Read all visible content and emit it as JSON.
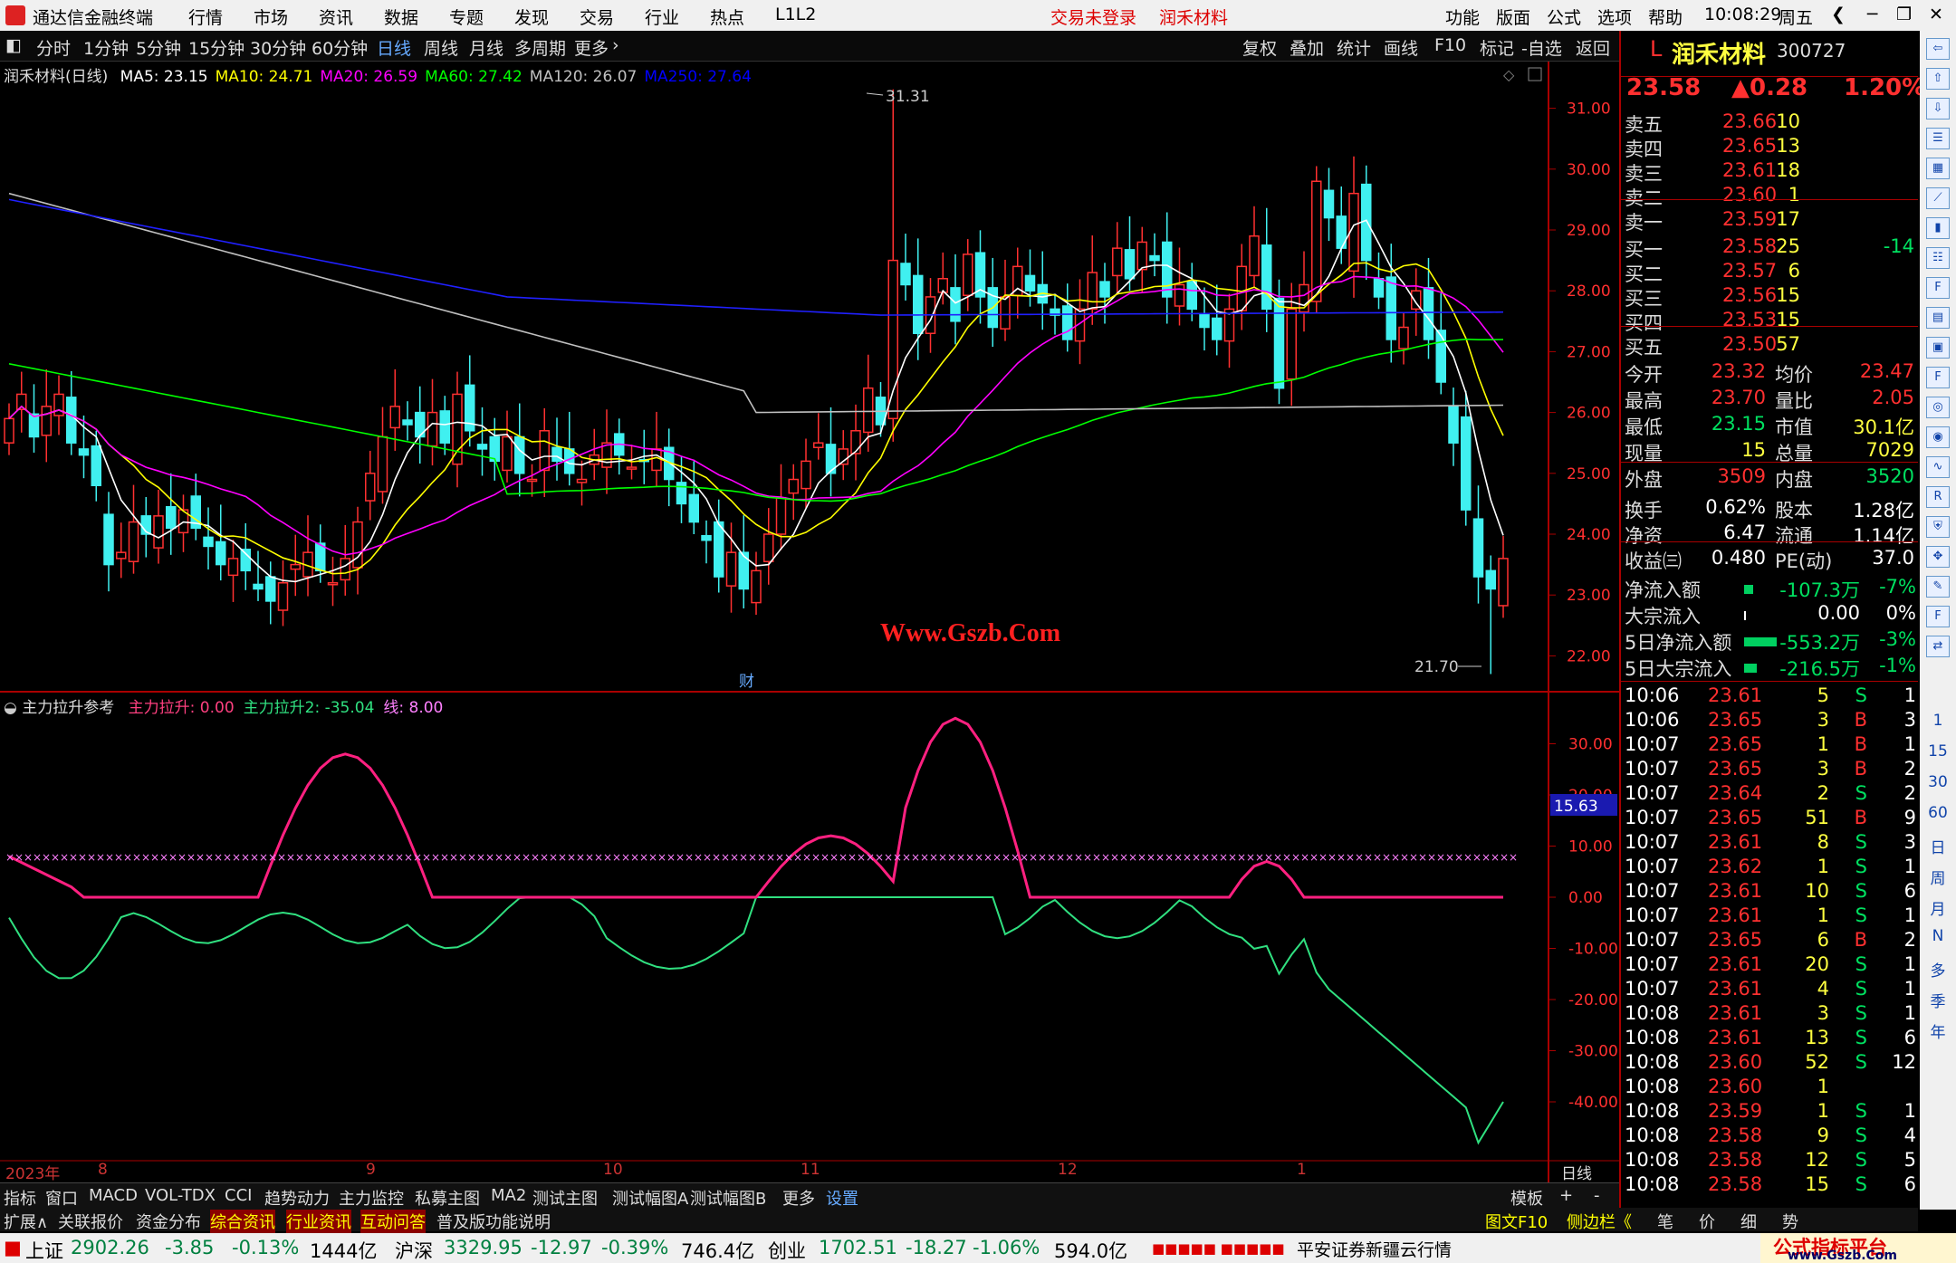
{
  "titlebar": {
    "app": "通达信金融终端",
    "menu": [
      "行情",
      "市场",
      "资讯",
      "数据",
      "专题",
      "发现",
      "交易",
      "行业",
      "热点",
      "L1L2"
    ],
    "trade_status": "交易未登录",
    "stock_center": "润禾材料",
    "right_menu": [
      "功能",
      "版面",
      "公式",
      "选项",
      "帮助"
    ],
    "time": "10:08:29",
    "weekday": "周五"
  },
  "toolbar": {
    "periods": [
      "分时",
      "1分钟",
      "5分钟",
      "15分钟",
      "30分钟",
      "60分钟",
      "日线",
      "周线",
      "月线",
      "多周期",
      "更多"
    ],
    "active": "日线",
    "right": [
      "复权",
      "叠加",
      "统计",
      "画线",
      "F10",
      "标记",
      "-自选",
      "返回"
    ]
  },
  "main_legend": {
    "name": "润禾材料(日线)",
    "items": [
      {
        "label": "MA5: 23.15",
        "color": "#ffffff"
      },
      {
        "label": "MA10: 24.71",
        "color": "#ffff00"
      },
      {
        "label": "MA20: 26.59",
        "color": "#ff00ff"
      },
      {
        "label": "MA60: 27.42",
        "color": "#00ff00"
      },
      {
        "label": "MA120: 26.07",
        "color": "#c0c0c0"
      },
      {
        "label": "MA250: 27.64",
        "color": "#0000ff"
      }
    ]
  },
  "price_axis": [
    "31.00",
    "30.00",
    "29.00",
    "28.00",
    "27.00",
    "26.00",
    "25.00",
    "24.00",
    "23.00",
    "22.00"
  ],
  "price_marks": {
    "high": "31.31",
    "low": "21.70"
  },
  "watermark": "Www.Gszb.Com",
  "cai": "财",
  "sub_legend": {
    "name": "主力拉升参考",
    "items": [
      {
        "label": "主力拉升: 0.00",
        "color": "#ff4080"
      },
      {
        "label": "主力拉升2: -35.04",
        "color": "#30e080"
      },
      {
        "label": "线: 8.00",
        "color": "#ff80ff"
      }
    ]
  },
  "sub_axis": [
    "30.00",
    "20.00",
    "10.00",
    "0.00",
    "-10.00",
    "-20.00",
    "-30.00",
    "-40.00"
  ],
  "sub_mark": "15.63",
  "xaxis": {
    "labels": [
      "2023年",
      "8",
      "9",
      "10",
      "11",
      "12",
      "1"
    ],
    "right": "日线"
  },
  "chart_data": {
    "type": "candlestick",
    "ylim": [
      21.5,
      31.5
    ],
    "high": 31.31,
    "low": 21.7,
    "closes": [
      25.9,
      26.3,
      25.6,
      26.1,
      26.3,
      25.5,
      25.3,
      24.8,
      23.5,
      23.7,
      24.2,
      24.0,
      24.3,
      24.1,
      24.4,
      24.1,
      23.8,
      23.5,
      23.6,
      23.4,
      23.1,
      22.9,
      23.2,
      23.5,
      23.7,
      23.4,
      23.2,
      23.6,
      24.2,
      25.0,
      25.6,
      26.1,
      25.8,
      25.6,
      26.0,
      25.5,
      26.3,
      25.7,
      25.4,
      25.2,
      25.6,
      25.0,
      24.9,
      25.7,
      25.2,
      25.0,
      24.9,
      25.3,
      25.5,
      25.3,
      25.1,
      25.2,
      25.4,
      24.9,
      24.5,
      24.2,
      23.9,
      23.3,
      23.7,
      23.1,
      23.4,
      24.0,
      24.6,
      24.9,
      25.2,
      25.5,
      25.0,
      25.4,
      25.7,
      26.4,
      25.8,
      28.5,
      28.1,
      27.3,
      27.9,
      28.2,
      27.5,
      28.6,
      27.9,
      27.4,
      27.9,
      28.4,
      28.0,
      27.8,
      27.6,
      27.2,
      27.7,
      28.3,
      27.9,
      28.7,
      28.2,
      28.8,
      28.5,
      27.9,
      28.1,
      27.7,
      27.4,
      27.2,
      27.7,
      28.4,
      28.9,
      27.7,
      26.4,
      27.7,
      28.1,
      29.8,
      29.2,
      28.7,
      29.6,
      28.5,
      27.9,
      27.2,
      27.4,
      28.0,
      27.2,
      26.5,
      25.5,
      24.4,
      23.3,
      23.1,
      23.6
    ],
    "ma_last": {
      "MA5": 23.15,
      "MA10": 24.71,
      "MA20": 26.59,
      "MA60": 27.42,
      "MA120": 26.07,
      "MA250": 27.64
    }
  },
  "quote": {
    "name": "润禾材料",
    "code": "300727",
    "price": "23.58",
    "change": "▲0.28",
    "pct": "1.20%",
    "asks": [
      [
        "卖五",
        "23.66",
        "10"
      ],
      [
        "卖四",
        "23.65",
        "13"
      ],
      [
        "卖三",
        "23.61",
        "18"
      ],
      [
        "卖二",
        "23.60",
        "1"
      ],
      [
        "卖一",
        "23.59",
        "17"
      ]
    ],
    "bids": [
      [
        "买一",
        "23.58",
        "25",
        "-14"
      ],
      [
        "买二",
        "23.57",
        "6",
        ""
      ],
      [
        "买三",
        "23.56",
        "15",
        ""
      ],
      [
        "买四",
        "23.53",
        "15",
        ""
      ],
      [
        "买五",
        "23.50",
        "57",
        ""
      ]
    ],
    "stats": [
      [
        "今开",
        "23.32",
        "均价",
        "23.47"
      ],
      [
        "最高",
        "23.70",
        "量比",
        "2.05"
      ],
      [
        "最低",
        "23.15",
        "市值",
        "30.1亿"
      ],
      [
        "现量",
        "15",
        "总量",
        "7029"
      ],
      [
        "外盘",
        "3509",
        "内盘",
        "3520"
      ]
    ],
    "fin": [
      [
        "换手",
        "0.62%",
        "股本",
        "1.28亿"
      ],
      [
        "净资",
        "6.47",
        "流通",
        "1.14亿"
      ],
      [
        "收益㈢",
        "0.480",
        "PE(动)",
        "37.0"
      ]
    ],
    "flow": [
      [
        "净流入额",
        "-107.3万",
        "-7%"
      ],
      [
        "大宗流入",
        "0.00",
        "0%"
      ],
      [
        "5日净流入额",
        "-553.2万",
        "-3%"
      ],
      [
        "5日大宗流入",
        "-216.5万",
        "-1%"
      ]
    ],
    "ticks": [
      [
        "10:06",
        "23.61",
        "5",
        "S",
        "1"
      ],
      [
        "10:06",
        "23.65",
        "3",
        "B",
        "3"
      ],
      [
        "10:07",
        "23.65",
        "1",
        "B",
        "1"
      ],
      [
        "10:07",
        "23.65",
        "3",
        "B",
        "2"
      ],
      [
        "10:07",
        "23.64",
        "2",
        "S",
        "2"
      ],
      [
        "10:07",
        "23.65",
        "51",
        "B",
        "9"
      ],
      [
        "10:07",
        "23.61",
        "8",
        "S",
        "3"
      ],
      [
        "10:07",
        "23.62",
        "1",
        "S",
        "1"
      ],
      [
        "10:07",
        "23.61",
        "10",
        "S",
        "6"
      ],
      [
        "10:07",
        "23.61",
        "1",
        "S",
        "1"
      ],
      [
        "10:07",
        "23.65",
        "6",
        "B",
        "2"
      ],
      [
        "10:07",
        "23.61",
        "20",
        "S",
        "1"
      ],
      [
        "10:07",
        "23.61",
        "4",
        "S",
        "1"
      ],
      [
        "10:08",
        "23.61",
        "3",
        "S",
        "1"
      ],
      [
        "10:08",
        "23.61",
        "13",
        "S",
        "6"
      ],
      [
        "10:08",
        "23.60",
        "52",
        "S",
        "12"
      ],
      [
        "10:08",
        "23.60",
        "1",
        "",
        ""
      ],
      [
        "10:08",
        "23.59",
        "1",
        "S",
        "1"
      ],
      [
        "10:08",
        "23.58",
        "9",
        "S",
        "4"
      ],
      [
        "10:08",
        "23.58",
        "12",
        "S",
        "5"
      ],
      [
        "10:08",
        "23.58",
        "15",
        "S",
        "6"
      ]
    ]
  },
  "side_icons": [
    "1",
    "15",
    "30",
    "60",
    "日",
    "周",
    "月",
    "N",
    "多",
    "季",
    "年"
  ],
  "tabs1": [
    "指标",
    "窗口",
    "MACD",
    "VOL-TDX",
    "CCI",
    "趋势动力",
    "主力监控",
    "私募主图",
    "MA2",
    "测试主图",
    "测试幅图A",
    "测试幅图B",
    "更多",
    "设置"
  ],
  "tabs1_right": [
    "模板",
    "+",
    "-"
  ],
  "tabs2": [
    "扩展∧",
    "关联报价",
    "资金分布",
    "综合资讯",
    "行业资讯",
    "互动问答",
    "普及版功能说明"
  ],
  "tabs2_right": [
    "图文F10",
    "侧边栏《",
    "笔",
    "价",
    "细",
    "势"
  ],
  "status": {
    "sh_name": "上证",
    "sh_val": "2902.26",
    "sh_chg": "-3.85",
    "sh_pct": "-0.13%",
    "sh_amt": "1444亿",
    "hs_name": "沪深",
    "hs_val": "3329.95",
    "hs_chg": "-12.97",
    "hs_pct": "-0.39%",
    "hs_amt": "746.4亿",
    "cy_name": "创业",
    "cy_val": "1702.51",
    "cy_chg": "-18.27",
    "cy_pct": "-1.06%",
    "cy_amt": "594.0亿",
    "broker": "平安证券新疆云行情",
    "brand": "公式指标平台",
    "brand_url": "www.Gszb.Com"
  }
}
